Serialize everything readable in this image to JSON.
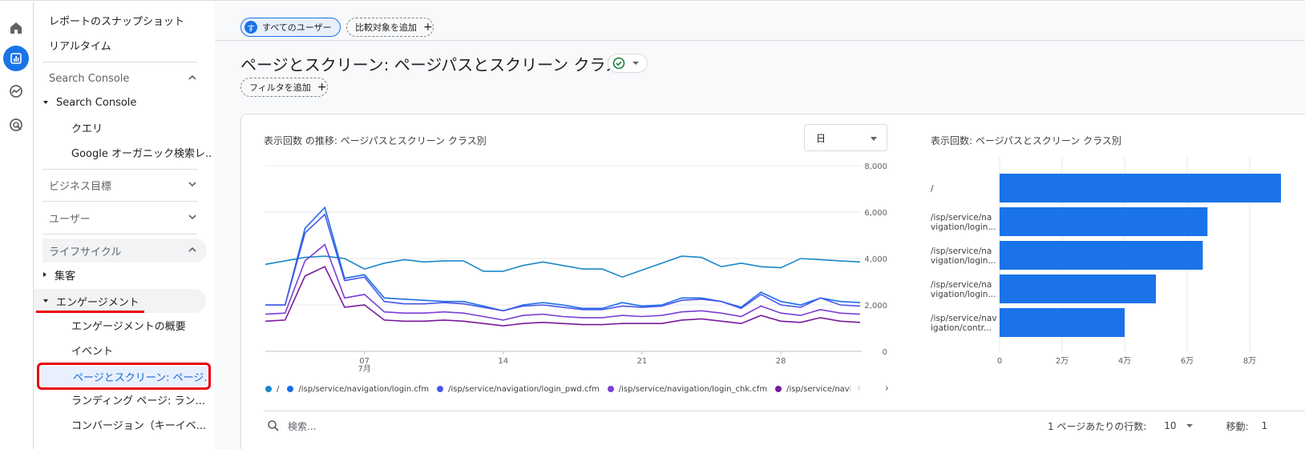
{
  "rail": {
    "icons": [
      "home-icon",
      "reports-icon",
      "explore-icon",
      "advertising-icon"
    ]
  },
  "nav": {
    "top_items": [
      "レポートのスナップショット",
      "リアルタイム"
    ],
    "search_console_section": "Search Console",
    "search_console_group": "Search Console",
    "search_console_children": [
      "クエリ",
      "Google オーガニック検索レ..."
    ],
    "business_section": "ビジネス目標",
    "user_section": "ユーザー",
    "lifecycle_section": "ライフサイクル",
    "acquisition_group": "集客",
    "engagement_group": "エンゲージメント",
    "engagement_children": [
      "エンゲージメントの概要",
      "イベント"
    ],
    "selected_item": "ページとスクリーン: ページ...",
    "more_items": [
      "ランディング ページ: ラン...",
      "コンバージョン（キーイベ..."
    ]
  },
  "header": {
    "users_chip_avatar": "す",
    "users_chip_label": "すべてのユーザー",
    "compare_chip_label": "比較対象を追加",
    "page_title": "ページとスクリーン: ページパスとスクリーン クラス",
    "filter_chip_label": "フィルタを追加"
  },
  "line_chart_panel": {
    "title": "表示回数 の推移: ページパスとスクリーン クラス別",
    "granularity": "日"
  },
  "bar_chart_panel": {
    "title": "表示回数: ページパスとスクリーン クラス別"
  },
  "table_controls": {
    "search_placeholder": "検索...",
    "rows_per_page_label": "1 ページあたりの行数:",
    "rows_per_page_value": "10",
    "goto_label": "移動:",
    "goto_value": "1"
  },
  "colors": {
    "series": [
      "#1a88c9",
      "#1b6fe8",
      "#4a57e8",
      "#7b3fd6",
      "#7a1a9b"
    ],
    "bar": "#1a73e8",
    "accent": "#1a73e8",
    "highlight_red": "#e8000b"
  },
  "chart_data": [
    {
      "type": "line",
      "x": [
        "7/1",
        "7/2",
        "7/3",
        "7/4",
        "7/5",
        "7/6",
        "7/7",
        "7/8",
        "7/9",
        "7/10",
        "7/11",
        "7/12",
        "7/13",
        "7/14",
        "7/15",
        "7/16",
        "7/17",
        "7/18",
        "7/19",
        "7/20",
        "7/21",
        "7/22",
        "7/23",
        "7/24",
        "7/25",
        "7/26",
        "7/27",
        "7/28",
        "7/29",
        "7/30",
        "7/31"
      ],
      "x_ticks": [
        {
          "label": "07",
          "sublabel": "7月",
          "index": 5
        },
        {
          "label": "14",
          "index": 12
        },
        {
          "label": "21",
          "index": 19
        },
        {
          "label": "28",
          "index": 26
        }
      ],
      "ylim": [
        0,
        8000
      ],
      "y_ticks": [
        "0",
        "2,000",
        "4,000",
        "6,000",
        "8,000"
      ],
      "grid": true,
      "legend_position": "bottom",
      "series": [
        {
          "name": "/",
          "values": [
            3750,
            3900,
            4050,
            4100,
            4000,
            3550,
            3800,
            3950,
            3850,
            3900,
            3900,
            3450,
            3450,
            3700,
            3850,
            3700,
            3550,
            3550,
            3200,
            3500,
            3800,
            4100,
            4050,
            3650,
            3800,
            3650,
            3600,
            4000,
            3950,
            3900,
            3850
          ]
        },
        {
          "name": "/isp/service/navigation/login.cfm",
          "values": [
            2000,
            2000,
            5300,
            6200,
            3150,
            3300,
            2300,
            2250,
            2200,
            2150,
            2150,
            1950,
            1750,
            2000,
            2100,
            2000,
            1850,
            1850,
            2100,
            1950,
            2000,
            2300,
            2300,
            2150,
            1900,
            2550,
            2150,
            2000,
            2300,
            2150,
            2100
          ]
        },
        {
          "name": "/isp/service/navigation/login_pwd.cfm",
          "values": [
            2000,
            2000,
            5100,
            5900,
            3050,
            3200,
            2150,
            2050,
            2050,
            2100,
            2050,
            1900,
            1750,
            1950,
            2000,
            1900,
            1800,
            1800,
            1950,
            1900,
            1950,
            2200,
            2250,
            2150,
            1850,
            2450,
            2000,
            1900,
            2300,
            2000,
            1950
          ]
        },
        {
          "name": "/isp/service/navigation/login_chk.cfm",
          "values": [
            1600,
            1650,
            3900,
            4600,
            2300,
            2450,
            1700,
            1650,
            1650,
            1700,
            1650,
            1500,
            1350,
            1550,
            1600,
            1500,
            1450,
            1450,
            1550,
            1500,
            1550,
            1700,
            1750,
            1650,
            1500,
            1950,
            1650,
            1550,
            1800,
            1650,
            1600
          ]
        },
        {
          "name": "/isp/service/navigation...",
          "values": [
            1300,
            1350,
            3250,
            3650,
            1900,
            2000,
            1350,
            1300,
            1300,
            1350,
            1300,
            1200,
            1100,
            1200,
            1250,
            1200,
            1150,
            1150,
            1200,
            1200,
            1200,
            1350,
            1400,
            1300,
            1200,
            1550,
            1300,
            1250,
            1450,
            1300,
            1250
          ]
        }
      ]
    },
    {
      "type": "bar",
      "orientation": "horizontal",
      "categories": [
        "/",
        "/isp/service/navigation/login...",
        "/isp/service/navigation/login...",
        "/isp/service/navigation/login...",
        "/isp/service/navigation/contr..."
      ],
      "category_lines": [
        [
          "/"
        ],
        [
          "/isp/service/na",
          "vigation/login..."
        ],
        [
          "/isp/service/na",
          "vigation/login..."
        ],
        [
          "/isp/service/na",
          "vigation/login..."
        ],
        [
          "/isp/service/nav",
          "igation/contr..."
        ]
      ],
      "values": [
        90000,
        66500,
        65000,
        50000,
        40000
      ],
      "xlim": [
        0,
        80000
      ],
      "x_ticks": [
        "0",
        "2万",
        "4万",
        "6万",
        "8万"
      ],
      "grid": true
    }
  ]
}
